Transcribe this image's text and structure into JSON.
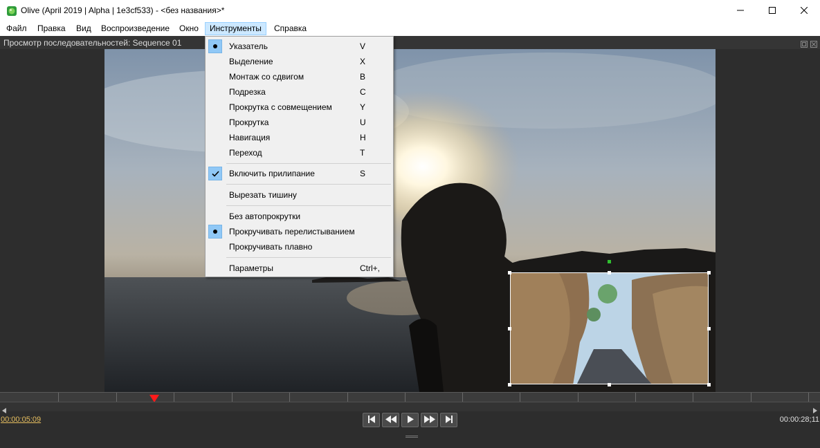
{
  "window": {
    "title": "Olive (April 2019 | Alpha | 1e3cf533) - <без названия>*",
    "minimize_icon": "minimize-icon",
    "maximize_icon": "maximize-icon",
    "close_icon": "close-icon"
  },
  "menubar": {
    "items": [
      "Файл",
      "Правка",
      "Вид",
      "Воспроизведение",
      "Окно",
      "Инструменты",
      "Справка"
    ],
    "active": "Инструменты"
  },
  "viewer": {
    "title": "Просмотр последовательностей: Sequence 01",
    "current_time": "00:00:05:09",
    "end_time": "00:00:28;11"
  },
  "playback": {
    "buttons": [
      "go-to-start-icon",
      "rewind-icon",
      "play-icon",
      "fast-forward-icon",
      "go-to-end-icon"
    ]
  },
  "tools_menu": {
    "items": [
      {
        "label": "Указатель",
        "shortcut": "V",
        "mark": "dot"
      },
      {
        "label": "Выделение",
        "shortcut": "X",
        "mark": ""
      },
      {
        "label": "Монтаж со сдвигом",
        "shortcut": "B",
        "mark": ""
      },
      {
        "label": "Подрезка",
        "shortcut": "C",
        "mark": ""
      },
      {
        "label": "Прокрутка с совмещением",
        "shortcut": "Y",
        "mark": ""
      },
      {
        "label": "Прокрутка",
        "shortcut": "U",
        "mark": ""
      },
      {
        "label": "Навигация",
        "shortcut": "H",
        "mark": ""
      },
      {
        "label": "Переход",
        "shortcut": "T",
        "mark": ""
      },
      {
        "label": "Включить прилипание",
        "shortcut": "S",
        "mark": "check"
      },
      {
        "label": "Вырезать тишину",
        "shortcut": "",
        "mark": ""
      },
      {
        "label": "Без автопрокрутки",
        "shortcut": "",
        "mark": ""
      },
      {
        "label": "Прокручивать перелистыванием",
        "shortcut": "",
        "mark": "dot"
      },
      {
        "label": "Прокручивать плавно",
        "shortcut": "",
        "mark": ""
      },
      {
        "label": "Параметры",
        "shortcut": "Ctrl+,",
        "mark": ""
      }
    ]
  },
  "colors": {
    "accent_menu_hover": "#cce8ff",
    "mark_bg": "#90c8f6",
    "timecode": "#e8c060",
    "playhead": "#ff1a1a"
  }
}
